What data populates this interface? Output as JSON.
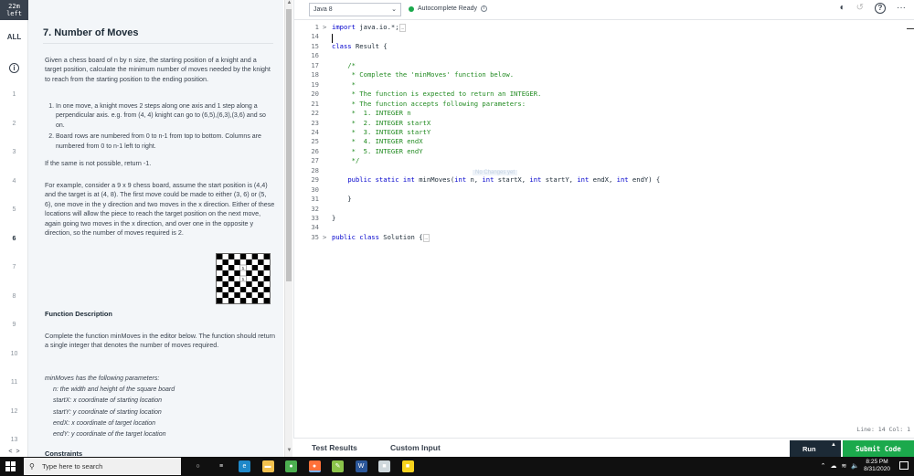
{
  "timer": {
    "line1": "22m",
    "line2": "left"
  },
  "rail": {
    "all_label": "ALL",
    "info_icon": "i",
    "questions": [
      "1",
      "2",
      "3",
      "4",
      "5",
      "6",
      "7",
      "8",
      "9",
      "10",
      "11",
      "12",
      "13"
    ],
    "active_question": "6",
    "arrow_left": "<",
    "arrow_right": ">"
  },
  "problem": {
    "title": "7. Number of Moves",
    "intro": "Given a chess board of n by n size, the starting position of a knight and a target position, calculate the minimum number of moves needed by the knight to reach from the starting position to the ending position.",
    "list": [
      "In one move, a knight moves 2 steps along one axis and 1 step along a perpendicular axis. e.g. from (4, 4) knight can go to (6,5),(6,3),(3,6) and so on.",
      "Board rows are numbered from 0 to n-1 from top to bottom. Columns are numbered from 0 to n-1 left to right."
    ],
    "impossible": "If the same is not possible, return -1.",
    "example": "For example, consider a 9 x 9 chess board, assume the start position is (4,4) and the target is at (4, 8). The first move could be made to either (3, 6) or (5, 6), one move in the y direction and two moves in the x direction. Either of these locations will allow the piece to reach the target position on the next move, again going two moves in the x direction, and over one in the opposite y direction, so the number of moves required is 2.",
    "func_desc_heading": "Function Description",
    "func_desc": "Complete the function minMoves in the editor below. The function should return a single integer that denotes the number of moves required.",
    "params_heading": "minMoves has  the following parameters:",
    "params": [
      "n: the width and height of the square board",
      "startX: x coordinate of starting location",
      "startY: y coordinate of starting location",
      "endX: x coordinate of target location",
      "endY: y coordinate of the target location"
    ],
    "constraints_heading": "Constraints",
    "board_size": 9,
    "board_marks": [
      "1",
      "1"
    ]
  },
  "editor": {
    "language": "Java 8",
    "autocomplete": "Autocomplete Ready",
    "status_color": "#1ba94c",
    "toolbar_icons": [
      "theme-toggle-icon",
      "reset-icon",
      "help-icon",
      "more-icon"
    ],
    "hint": "No Changes yet",
    "line_col": "Line: 14 Col: 1",
    "lines": [
      {
        "n": "1",
        "fold": ">",
        "html": "<span class='kw'>import</span> java.io.*;<span class='fold-mark'>…</span>"
      },
      {
        "n": "14",
        "fold": "",
        "html": ""
      },
      {
        "n": "15",
        "fold": "",
        "html": "<span class='kw'>class</span> Result {"
      },
      {
        "n": "16",
        "fold": "",
        "html": ""
      },
      {
        "n": "17",
        "fold": "",
        "html": "    <span class='cm'>/*</span>"
      },
      {
        "n": "18",
        "fold": "",
        "html": "<span class='cm'>     * Complete the 'minMoves' function below.</span>"
      },
      {
        "n": "19",
        "fold": "",
        "html": "<span class='cm'>     *</span>"
      },
      {
        "n": "20",
        "fold": "",
        "html": "<span class='cm'>     * The function is expected to return an INTEGER.</span>"
      },
      {
        "n": "21",
        "fold": "",
        "html": "<span class='cm'>     * The function accepts following parameters:</span>"
      },
      {
        "n": "22",
        "fold": "",
        "html": "<span class='cm'>     *  1. INTEGER n</span>"
      },
      {
        "n": "23",
        "fold": "",
        "html": "<span class='cm'>     *  2. INTEGER startX</span>"
      },
      {
        "n": "24",
        "fold": "",
        "html": "<span class='cm'>     *  3. INTEGER startY</span>"
      },
      {
        "n": "25",
        "fold": "",
        "html": "<span class='cm'>     *  4. INTEGER endX</span>"
      },
      {
        "n": "26",
        "fold": "",
        "html": "<span class='cm'>     *  5. INTEGER endY</span>"
      },
      {
        "n": "27",
        "fold": "",
        "html": "<span class='cm'>     */</span>"
      },
      {
        "n": "28",
        "fold": "",
        "html": ""
      },
      {
        "n": "29",
        "fold": "",
        "html": "    <span class='kw'>public static int</span> minMoves(<span class='kw'>int</span> n, <span class='kw'>int</span> startX, <span class='kw'>int</span> startY, <span class='kw'>int</span> endX, <span class='kw'>int</span> endY) {"
      },
      {
        "n": "30",
        "fold": "",
        "html": ""
      },
      {
        "n": "31",
        "fold": "",
        "html": "    }"
      },
      {
        "n": "32",
        "fold": "",
        "html": ""
      },
      {
        "n": "33",
        "fold": "",
        "html": "}"
      },
      {
        "n": "34",
        "fold": "",
        "html": ""
      },
      {
        "n": "35",
        "fold": ">",
        "html": "<span class='kw'>public class</span> Solution {<span class='fold-mark'>…</span>"
      }
    ]
  },
  "bottom": {
    "test_results": "Test Results",
    "custom_input": "Custom Input",
    "run": "Run",
    "run_caret": "▲",
    "submit": "Submit Code"
  },
  "taskbar": {
    "search_placeholder": "Type here to search",
    "time": "8:25 PM",
    "date": "8/31/2020",
    "apps": [
      {
        "name": "cortana-icon",
        "glyph": "○",
        "color": "transparent"
      },
      {
        "name": "task-view-icon",
        "glyph": "≡",
        "color": "transparent"
      },
      {
        "name": "edge-icon",
        "glyph": "e",
        "color": "#1e88c9"
      },
      {
        "name": "file-explorer-icon",
        "glyph": "▬",
        "color": "#f2c14e"
      },
      {
        "name": "chrome-icon",
        "glyph": "●",
        "color": "#4caf50"
      },
      {
        "name": "firefox-icon",
        "glyph": "●",
        "color": "#ff7139"
      },
      {
        "name": "notepad-plus-icon",
        "glyph": "✎",
        "color": "#8bc34a"
      },
      {
        "name": "word-icon",
        "glyph": "W",
        "color": "#2b579a"
      },
      {
        "name": "file-icon",
        "glyph": "■",
        "color": "#cfd8dc"
      },
      {
        "name": "sticky-notes-icon",
        "glyph": "■",
        "color": "#f7d31d"
      }
    ]
  }
}
